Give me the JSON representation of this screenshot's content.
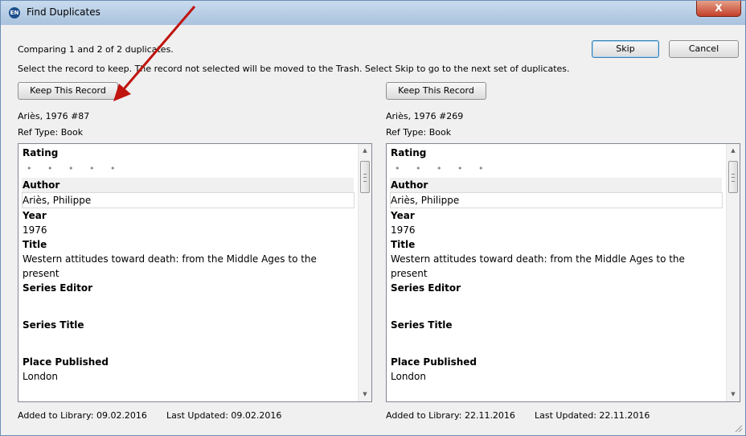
{
  "window": {
    "title": "Find Duplicates",
    "icon_text": "EN",
    "close_glyph": "X"
  },
  "header": {
    "comparing_text": "Comparing 1 and 2 of 2 duplicates.",
    "instruction_text": "Select the record to keep. The record not selected will be moved to the Trash. Select Skip to go to the next set of duplicates.",
    "skip_label": "Skip",
    "cancel_label": "Cancel"
  },
  "records": [
    {
      "keep_label": "Keep This Record",
      "ref_name": "Ariès, 1976 #87",
      "ref_type": "Ref Type: Book",
      "fields": {
        "rating_label": "Rating",
        "rating_dots": "• • • • •",
        "author_label": "Author",
        "author_value": "Ariès, Philippe",
        "year_label": "Year",
        "year_value": "1976",
        "title_label": "Title",
        "title_value": "Western attitudes toward death: from the Middle Ages to the present",
        "series_editor_label": "Series Editor",
        "series_title_label": "Series Title",
        "place_label": "Place Published",
        "place_value": "London"
      },
      "added": "Added to Library: 09.02.2016",
      "updated": "Last Updated: 09.02.2016"
    },
    {
      "keep_label": "Keep This Record",
      "ref_name": "Ariès, 1976 #269",
      "ref_type": "Ref Type: Book",
      "fields": {
        "rating_label": "Rating",
        "rating_dots": "• • • • •",
        "author_label": "Author",
        "author_value": "Ariès, Philippe",
        "year_label": "Year",
        "year_value": "1976",
        "title_label": "Title",
        "title_value": "Western attitudes toward death: from the Middle Ages to the present",
        "series_editor_label": "Series Editor",
        "series_title_label": "Series Title",
        "place_label": "Place Published",
        "place_value": "London"
      },
      "added": "Added to Library: 22.11.2016",
      "updated": "Last Updated: 22.11.2016"
    }
  ],
  "colors": {
    "annotation_arrow": "#c0140f",
    "titlebar": "#b7cde6",
    "close_button": "#c4402a"
  }
}
